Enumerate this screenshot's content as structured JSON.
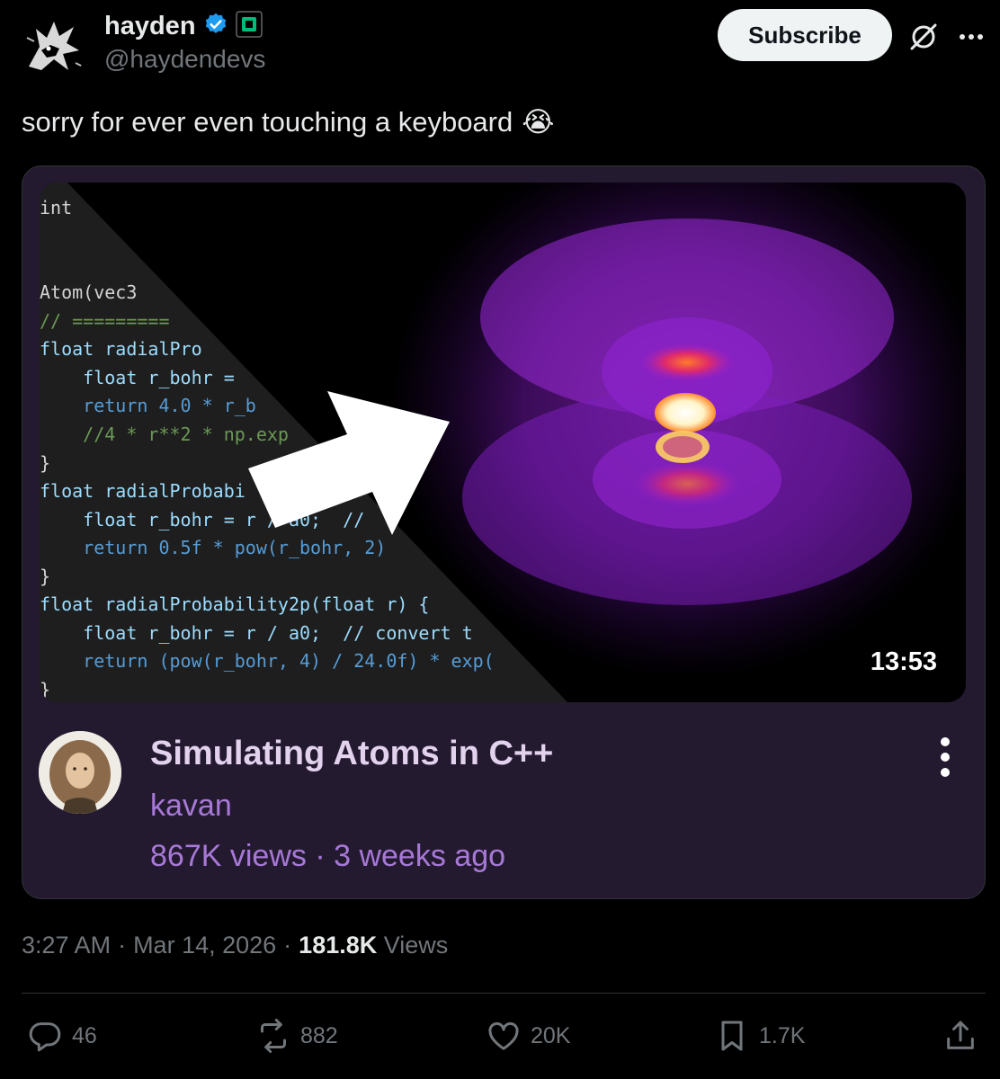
{
  "author": {
    "display_name": "hayden",
    "handle": "@haydendevs",
    "verified_icon": "verified-badge-icon",
    "affiliate_icon": "affiliate-badge-icon"
  },
  "header": {
    "subscribe_label": "Subscribe",
    "grok_icon": "grok-icon",
    "more_icon": "more-horizontal-icon"
  },
  "tweet": {
    "text": "sorry for ever even touching a keyboard",
    "emoji": "😭"
  },
  "video": {
    "duration": "13:53",
    "title": "Simulating Atoms in C++",
    "channel": "kavan",
    "views": "867K views",
    "separator": "·",
    "age": "3 weeks ago",
    "code_lines": [
      "int",
      "Atom(vec3 ",
      "// =========",
      "float radialPro",
      "    float r_bohr =",
      "    return 4.0 * r_b",
      "    //4 * r**2 * np.exp",
      "}",
      "float radialProbabi",
      "    float r_bohr = r / a0;  //",
      "    return 0.5f * pow(r_bohr, 2)",
      "}",
      "float radialProbability2p(float r) {",
      "    float r_bohr = r / a0;  // convert t",
      "    return (pow(r_bohr, 4) / 24.0f) * exp(",
      "}"
    ]
  },
  "meta": {
    "time": "3:27 AM",
    "dot": "·",
    "date": "Mar 14, 2026",
    "views_count": "181.8K",
    "views_label": "Views"
  },
  "actions": {
    "replies": "46",
    "reposts": "882",
    "likes": "20K",
    "bookmarks": "1.7K"
  },
  "colors": {
    "background": "#000000",
    "card_bg": "#241a30",
    "video_meta": "#a779d6",
    "muted": "#71767b",
    "verified": "#1d9bf0",
    "affiliate": "#00ba7c"
  }
}
